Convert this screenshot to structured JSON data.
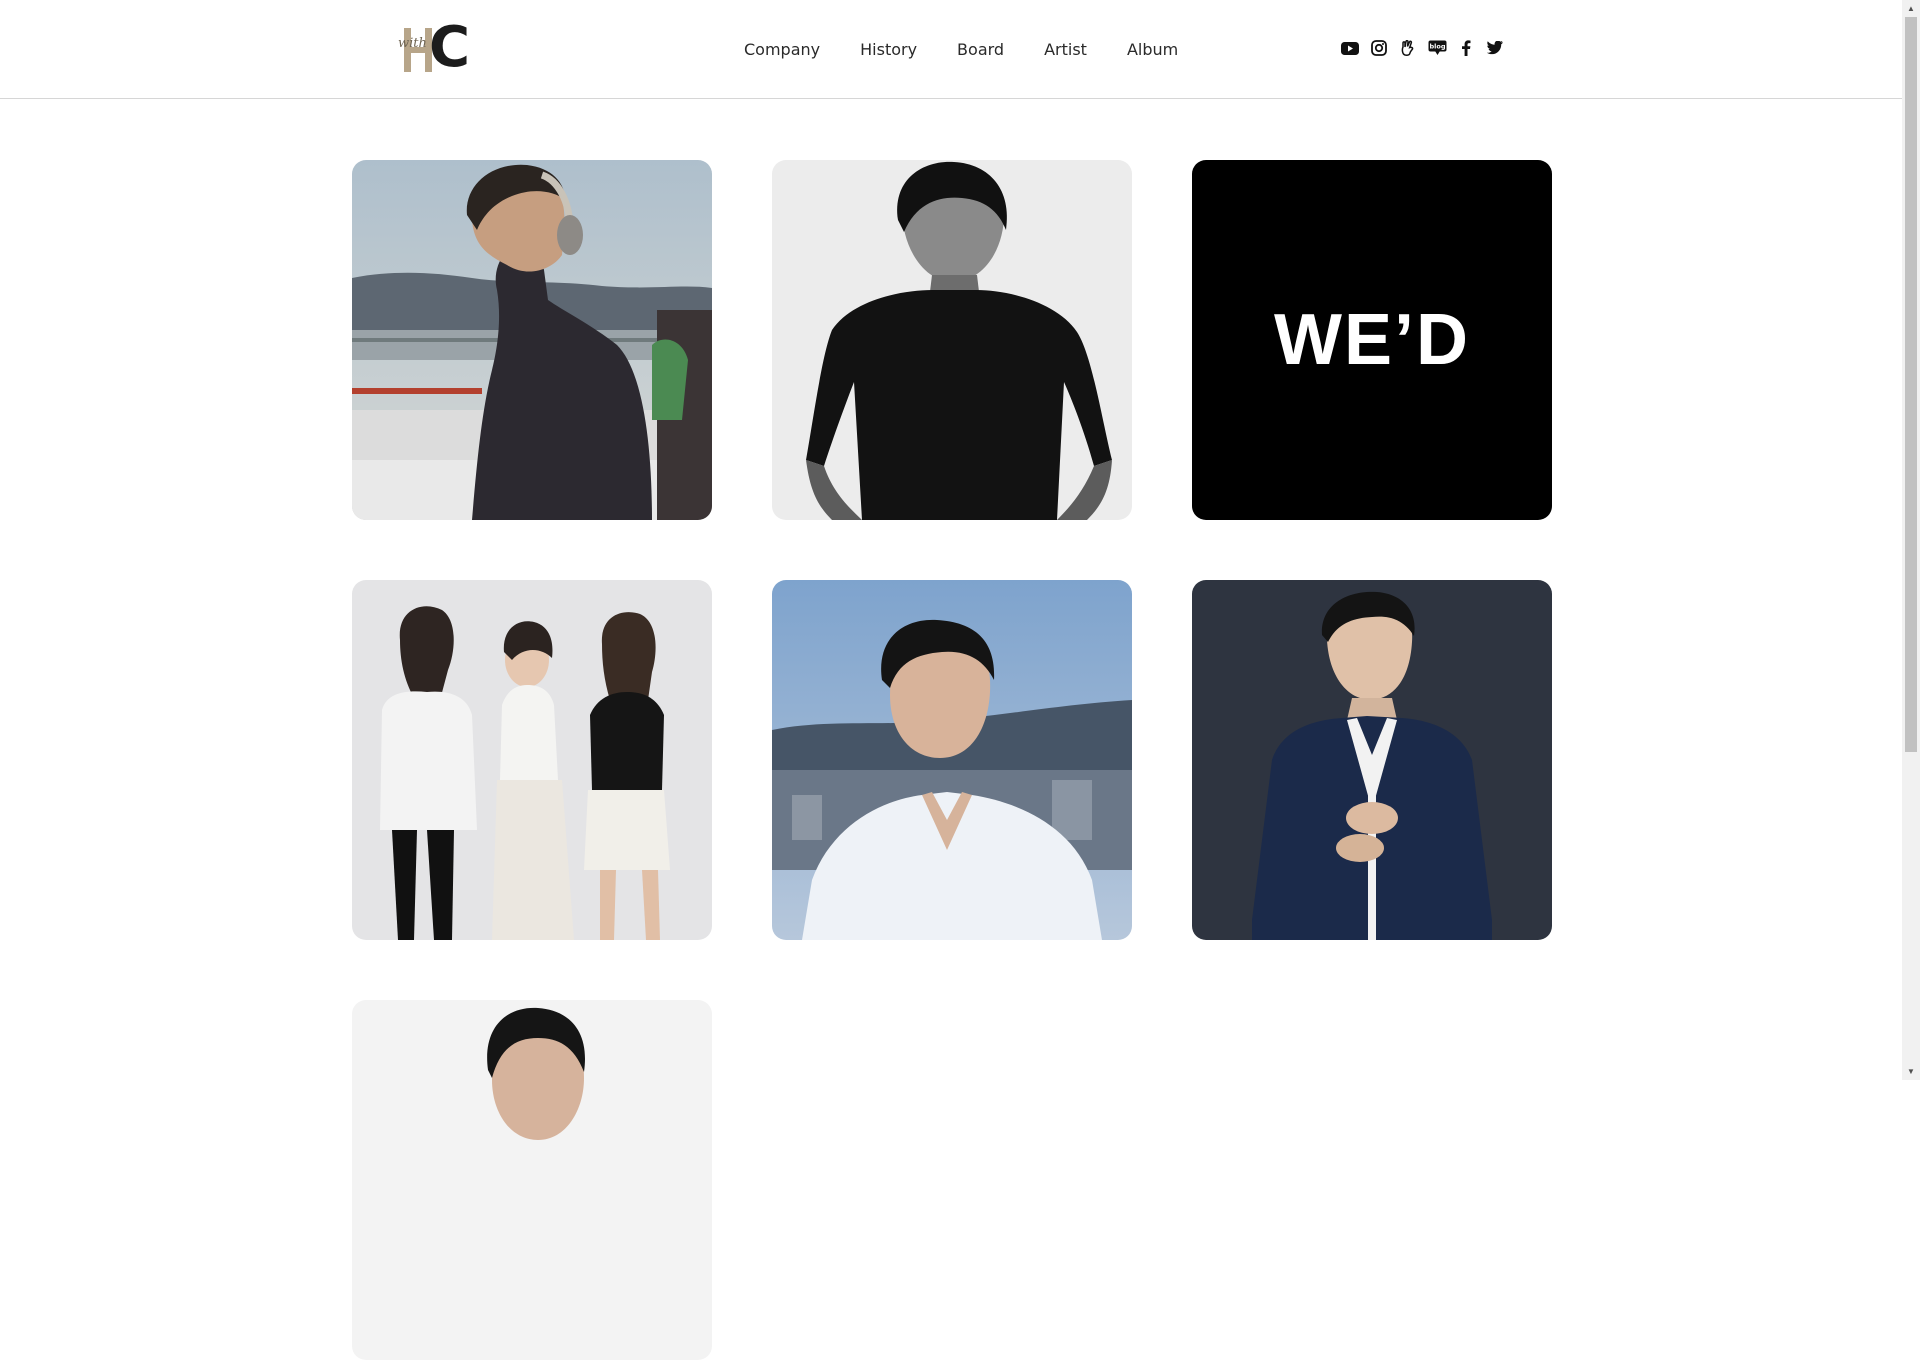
{
  "brand": {
    "logo_script": "with",
    "logo_letter": "C"
  },
  "nav": {
    "items": [
      {
        "label": "Company"
      },
      {
        "label": "History"
      },
      {
        "label": "Board"
      },
      {
        "label": "Artist"
      },
      {
        "label": "Album"
      }
    ]
  },
  "social": {
    "icons": [
      "youtube-icon",
      "instagram-icon",
      "cafe-icon",
      "blog-icon",
      "facebook-icon",
      "twitter-icon"
    ],
    "blog_label": "blog"
  },
  "artists": {
    "cards": [
      {
        "name": "artist-card-1",
        "theme": "outdoor-headphones"
      },
      {
        "name": "artist-card-2",
        "theme": "monochrome-portrait"
      },
      {
        "name": "artist-card-3",
        "theme": "text-logo",
        "text": "WE’D"
      },
      {
        "name": "artist-card-4",
        "theme": "group-trio"
      },
      {
        "name": "artist-card-5",
        "theme": "dusk-portrait"
      },
      {
        "name": "artist-card-6",
        "theme": "suit-portrait"
      },
      {
        "name": "artist-card-7",
        "theme": "partial-portrait"
      }
    ]
  },
  "colors": {
    "header_border": "#d6d6d6",
    "logo_gold": "#b7a589",
    "logo_dark": "#1c1c1c",
    "wed_card_bg": "#000000"
  }
}
